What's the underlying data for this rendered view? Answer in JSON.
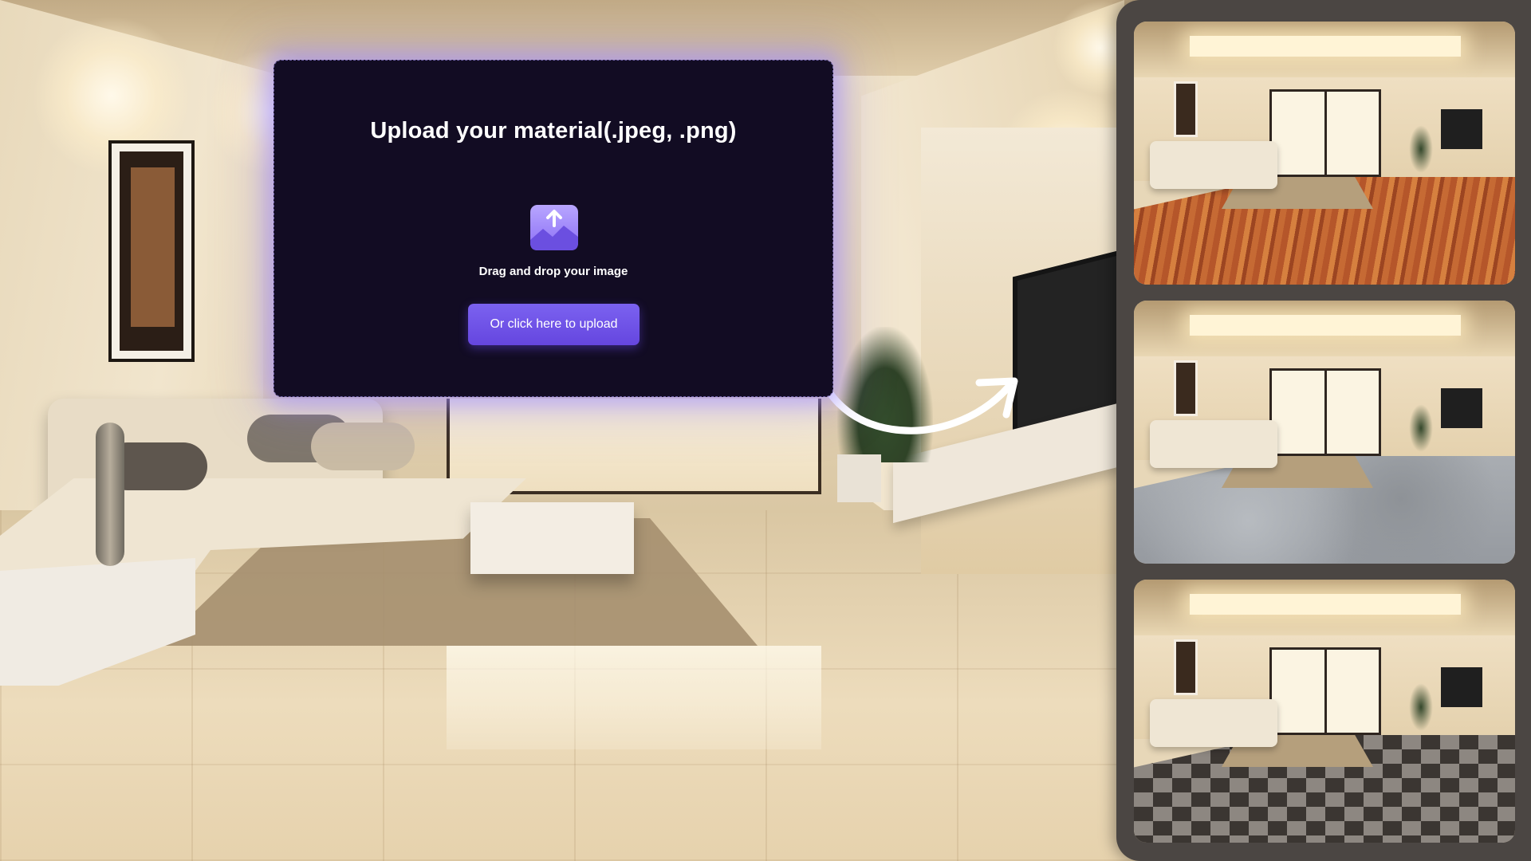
{
  "upload": {
    "title": "Upload your material(.jpeg, .png)",
    "drag_text": "Drag and drop your image",
    "button_label": "Or click here to upload",
    "icon": "image-upload-icon"
  },
  "previews": {
    "items": [
      {
        "floor_material": "wood"
      },
      {
        "floor_material": "concrete"
      },
      {
        "floor_material": "checkered-tile"
      }
    ]
  },
  "colors": {
    "card_background": "#120c23",
    "button_accent": "#6b4ce6",
    "glow": "#a08cff",
    "panel_background": "#4b4643"
  }
}
